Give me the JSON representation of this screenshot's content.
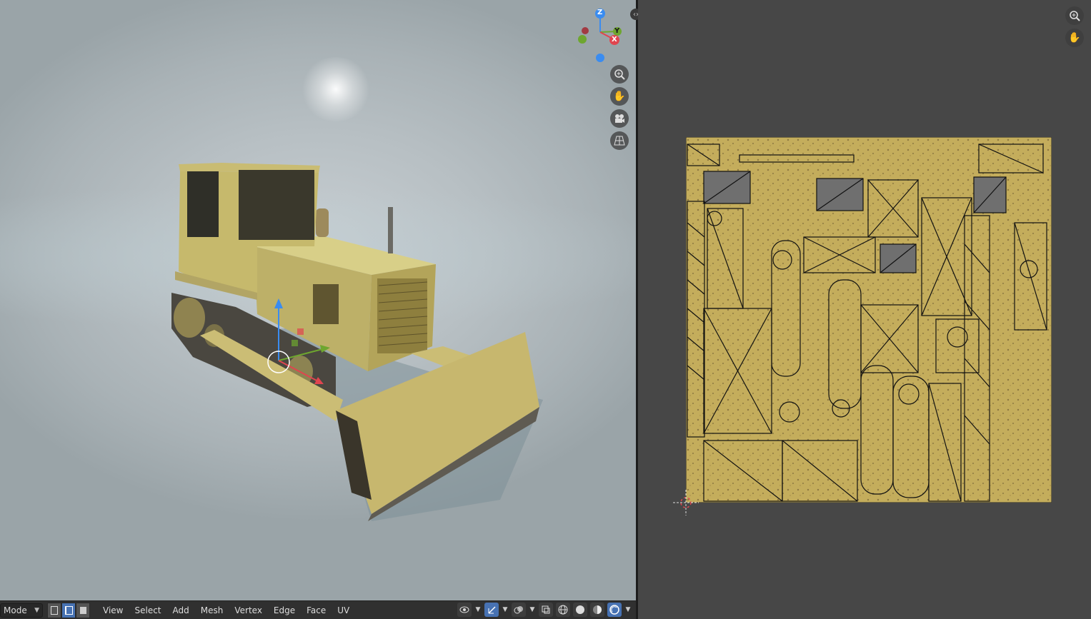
{
  "header": {
    "mode_label": "Mode",
    "menus": [
      "View",
      "Select",
      "Add",
      "Mesh",
      "Vertex",
      "Edge",
      "Face",
      "UV"
    ]
  },
  "gizmo": {
    "axis_z": "Z",
    "axis_y": "Y",
    "axis_x": "X"
  },
  "viewport_tools": [
    "zoom-icon",
    "pan-hand-icon",
    "camera-icon",
    "perspective-grid-icon"
  ],
  "uv_tools": [
    "zoom-icon",
    "pan-hand-icon"
  ],
  "colors": {
    "accent": "#4772b3",
    "x_axis": "#e0454f",
    "y_axis": "#6ea62f",
    "z_axis": "#3a8cf0",
    "texture_yellow": "#c9b35a"
  }
}
